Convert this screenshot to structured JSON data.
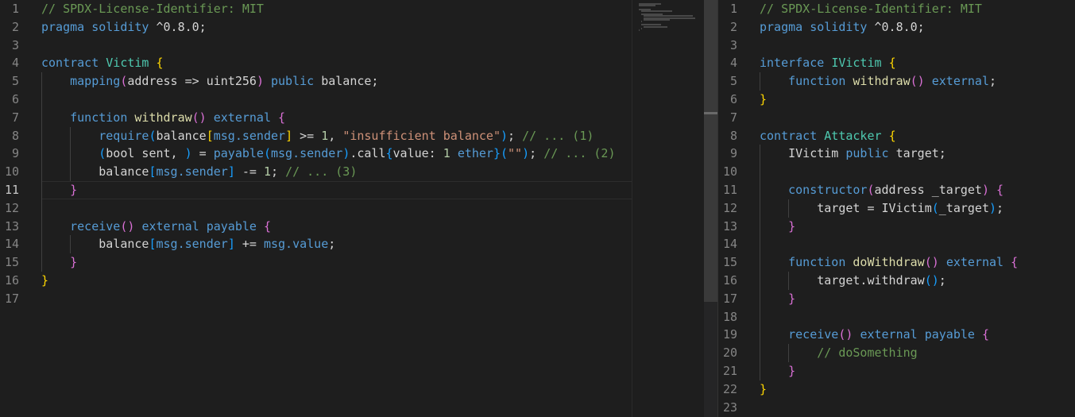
{
  "editor": {
    "theme_colors": {
      "background": "#1e1e1e",
      "comment": "#6a9955",
      "keyword": "#569cd6",
      "type": "#4ec9b0",
      "function": "#dcdcaa",
      "string": "#ce9178",
      "number": "#b5cea8",
      "bracket_level1": "#ffd700",
      "bracket_level2": "#da70d6",
      "bracket_level3": "#179fff",
      "line_number": "#858585"
    },
    "left": {
      "file_language": "solidity",
      "active_line": 11,
      "lines": [
        {
          "n": "1",
          "tokens": [
            [
              "cm",
              "// SPDX-License-Identifier: MIT"
            ]
          ]
        },
        {
          "n": "2",
          "tokens": [
            [
              "kw",
              "pragma"
            ],
            [
              "tx",
              " "
            ],
            [
              "kw",
              "solidity"
            ],
            [
              "tx",
              " ^0.8.0;"
            ]
          ]
        },
        {
          "n": "3",
          "tokens": []
        },
        {
          "n": "4",
          "tokens": [
            [
              "kw",
              "contract"
            ],
            [
              "tx",
              " "
            ],
            [
              "ty",
              "Victim"
            ],
            [
              "tx",
              " "
            ],
            [
              "b1",
              "{"
            ]
          ]
        },
        {
          "n": "5",
          "tokens": [
            [
              "tx",
              "    "
            ],
            [
              "kw",
              "mapping"
            ],
            [
              "b2",
              "("
            ],
            [
              "tx",
              "address => uint256"
            ],
            [
              "b2",
              ")"
            ],
            [
              "tx",
              " "
            ],
            [
              "kw",
              "public"
            ],
            [
              "tx",
              " balance;"
            ]
          ]
        },
        {
          "n": "6",
          "tokens": []
        },
        {
          "n": "7",
          "tokens": [
            [
              "tx",
              "    "
            ],
            [
              "kw",
              "function"
            ],
            [
              "tx",
              " "
            ],
            [
              "fn",
              "withdraw"
            ],
            [
              "b2",
              "()"
            ],
            [
              "tx",
              " "
            ],
            [
              "kw",
              "external"
            ],
            [
              "tx",
              " "
            ],
            [
              "b2",
              "{"
            ]
          ]
        },
        {
          "n": "8",
          "tokens": [
            [
              "tx",
              "        "
            ],
            [
              "kw",
              "require"
            ],
            [
              "b3",
              "("
            ],
            [
              "tx",
              "balance"
            ],
            [
              "b1",
              "["
            ],
            [
              "kw",
              "msg.sender"
            ],
            [
              "b1",
              "]"
            ],
            [
              "tx",
              " >= "
            ],
            [
              "nu",
              "1"
            ],
            [
              "tx",
              ", "
            ],
            [
              "st",
              "\"insufficient balance\""
            ],
            [
              "b3",
              ")"
            ],
            [
              "tx",
              "; "
            ],
            [
              "cm",
              "// ... (1)"
            ]
          ]
        },
        {
          "n": "9",
          "tokens": [
            [
              "tx",
              "        "
            ],
            [
              "b3",
              "("
            ],
            [
              "tx",
              "bool sent, "
            ],
            [
              "b3",
              ")"
            ],
            [
              "tx",
              " = "
            ],
            [
              "kw",
              "payable"
            ],
            [
              "b3",
              "("
            ],
            [
              "kw",
              "msg.sender"
            ],
            [
              "b3",
              ")"
            ],
            [
              "tx",
              ".call"
            ],
            [
              "b3",
              "{"
            ],
            [
              "tx",
              "value: "
            ],
            [
              "nu",
              "1"
            ],
            [
              "tx",
              " "
            ],
            [
              "kw",
              "ether"
            ],
            [
              "b3",
              "}("
            ],
            [
              "st",
              "\"\""
            ],
            [
              "b3",
              ")"
            ],
            [
              "tx",
              "; "
            ],
            [
              "cm",
              "// ... (2)"
            ]
          ]
        },
        {
          "n": "10",
          "tokens": [
            [
              "tx",
              "        balance"
            ],
            [
              "b3",
              "["
            ],
            [
              "kw",
              "msg.sender"
            ],
            [
              "b3",
              "]"
            ],
            [
              "tx",
              " -= "
            ],
            [
              "nu",
              "1"
            ],
            [
              "tx",
              "; "
            ],
            [
              "cm",
              "// ... (3)"
            ]
          ]
        },
        {
          "n": "11",
          "tokens": [
            [
              "tx",
              "    "
            ],
            [
              "b2",
              "}"
            ]
          ]
        },
        {
          "n": "12",
          "tokens": []
        },
        {
          "n": "13",
          "tokens": [
            [
              "tx",
              "    "
            ],
            [
              "kw",
              "receive"
            ],
            [
              "b2",
              "()"
            ],
            [
              "tx",
              " "
            ],
            [
              "kw",
              "external"
            ],
            [
              "tx",
              " "
            ],
            [
              "kw",
              "payable"
            ],
            [
              "tx",
              " "
            ],
            [
              "b2",
              "{"
            ]
          ]
        },
        {
          "n": "14",
          "tokens": [
            [
              "tx",
              "        balance"
            ],
            [
              "b3",
              "["
            ],
            [
              "kw",
              "msg.sender"
            ],
            [
              "b3",
              "]"
            ],
            [
              "tx",
              " += "
            ],
            [
              "kw",
              "msg.value"
            ],
            [
              "tx",
              ";"
            ]
          ]
        },
        {
          "n": "15",
          "tokens": [
            [
              "tx",
              "    "
            ],
            [
              "b2",
              "}"
            ]
          ]
        },
        {
          "n": "16",
          "tokens": [
            [
              "b1",
              "}"
            ]
          ]
        },
        {
          "n": "17",
          "tokens": []
        }
      ]
    },
    "right": {
      "file_language": "solidity",
      "lines": [
        {
          "n": "1",
          "tokens": [
            [
              "cm",
              "// SPDX-License-Identifier: MIT"
            ]
          ]
        },
        {
          "n": "2",
          "tokens": [
            [
              "kw",
              "pragma"
            ],
            [
              "tx",
              " "
            ],
            [
              "kw",
              "solidity"
            ],
            [
              "tx",
              " ^0.8.0;"
            ]
          ]
        },
        {
          "n": "3",
          "tokens": []
        },
        {
          "n": "4",
          "tokens": [
            [
              "kw",
              "interface"
            ],
            [
              "tx",
              " "
            ],
            [
              "ty",
              "IVictim"
            ],
            [
              "tx",
              " "
            ],
            [
              "b1",
              "{"
            ]
          ]
        },
        {
          "n": "5",
          "tokens": [
            [
              "tx",
              "    "
            ],
            [
              "kw",
              "function"
            ],
            [
              "tx",
              " "
            ],
            [
              "fn",
              "withdraw"
            ],
            [
              "b2",
              "()"
            ],
            [
              "tx",
              " "
            ],
            [
              "kw",
              "external"
            ],
            [
              "tx",
              ";"
            ]
          ]
        },
        {
          "n": "6",
          "tokens": [
            [
              "b1",
              "}"
            ]
          ]
        },
        {
          "n": "7",
          "tokens": []
        },
        {
          "n": "8",
          "tokens": [
            [
              "kw",
              "contract"
            ],
            [
              "tx",
              " "
            ],
            [
              "ty",
              "Attacker"
            ],
            [
              "tx",
              " "
            ],
            [
              "b1",
              "{"
            ]
          ]
        },
        {
          "n": "9",
          "tokens": [
            [
              "tx",
              "    IVictim "
            ],
            [
              "kw",
              "public"
            ],
            [
              "tx",
              " target;"
            ]
          ]
        },
        {
          "n": "10",
          "tokens": []
        },
        {
          "n": "11",
          "tokens": [
            [
              "tx",
              "    "
            ],
            [
              "kw",
              "constructor"
            ],
            [
              "b2",
              "("
            ],
            [
              "tx",
              "address _target"
            ],
            [
              "b2",
              ")"
            ],
            [
              "tx",
              " "
            ],
            [
              "b2",
              "{"
            ]
          ]
        },
        {
          "n": "12",
          "tokens": [
            [
              "tx",
              "        target = IVictim"
            ],
            [
              "b3",
              "("
            ],
            [
              "tx",
              "_target"
            ],
            [
              "b3",
              ")"
            ],
            [
              "tx",
              ";"
            ]
          ]
        },
        {
          "n": "13",
          "tokens": [
            [
              "tx",
              "    "
            ],
            [
              "b2",
              "}"
            ]
          ]
        },
        {
          "n": "14",
          "tokens": []
        },
        {
          "n": "15",
          "tokens": [
            [
              "tx",
              "    "
            ],
            [
              "kw",
              "function"
            ],
            [
              "tx",
              " "
            ],
            [
              "fn",
              "doWithdraw"
            ],
            [
              "b2",
              "()"
            ],
            [
              "tx",
              " "
            ],
            [
              "kw",
              "external"
            ],
            [
              "tx",
              " "
            ],
            [
              "b2",
              "{"
            ]
          ]
        },
        {
          "n": "16",
          "tokens": [
            [
              "tx",
              "        target.withdraw"
            ],
            [
              "b3",
              "()"
            ],
            [
              "tx",
              ";"
            ]
          ]
        },
        {
          "n": "17",
          "tokens": [
            [
              "tx",
              "    "
            ],
            [
              "b2",
              "}"
            ]
          ]
        },
        {
          "n": "18",
          "tokens": []
        },
        {
          "n": "19",
          "tokens": [
            [
              "tx",
              "    "
            ],
            [
              "kw",
              "receive"
            ],
            [
              "b2",
              "()"
            ],
            [
              "tx",
              " "
            ],
            [
              "kw",
              "external"
            ],
            [
              "tx",
              " "
            ],
            [
              "kw",
              "payable"
            ],
            [
              "tx",
              " "
            ],
            [
              "b2",
              "{"
            ]
          ]
        },
        {
          "n": "20",
          "tokens": [
            [
              "tx",
              "        "
            ],
            [
              "cm",
              "// doSomething"
            ]
          ]
        },
        {
          "n": "21",
          "tokens": [
            [
              "tx",
              "    "
            ],
            [
              "b2",
              "}"
            ]
          ]
        },
        {
          "n": "22",
          "tokens": [
            [
              "b1",
              "}"
            ]
          ]
        },
        {
          "n": "23",
          "tokens": []
        }
      ]
    }
  }
}
